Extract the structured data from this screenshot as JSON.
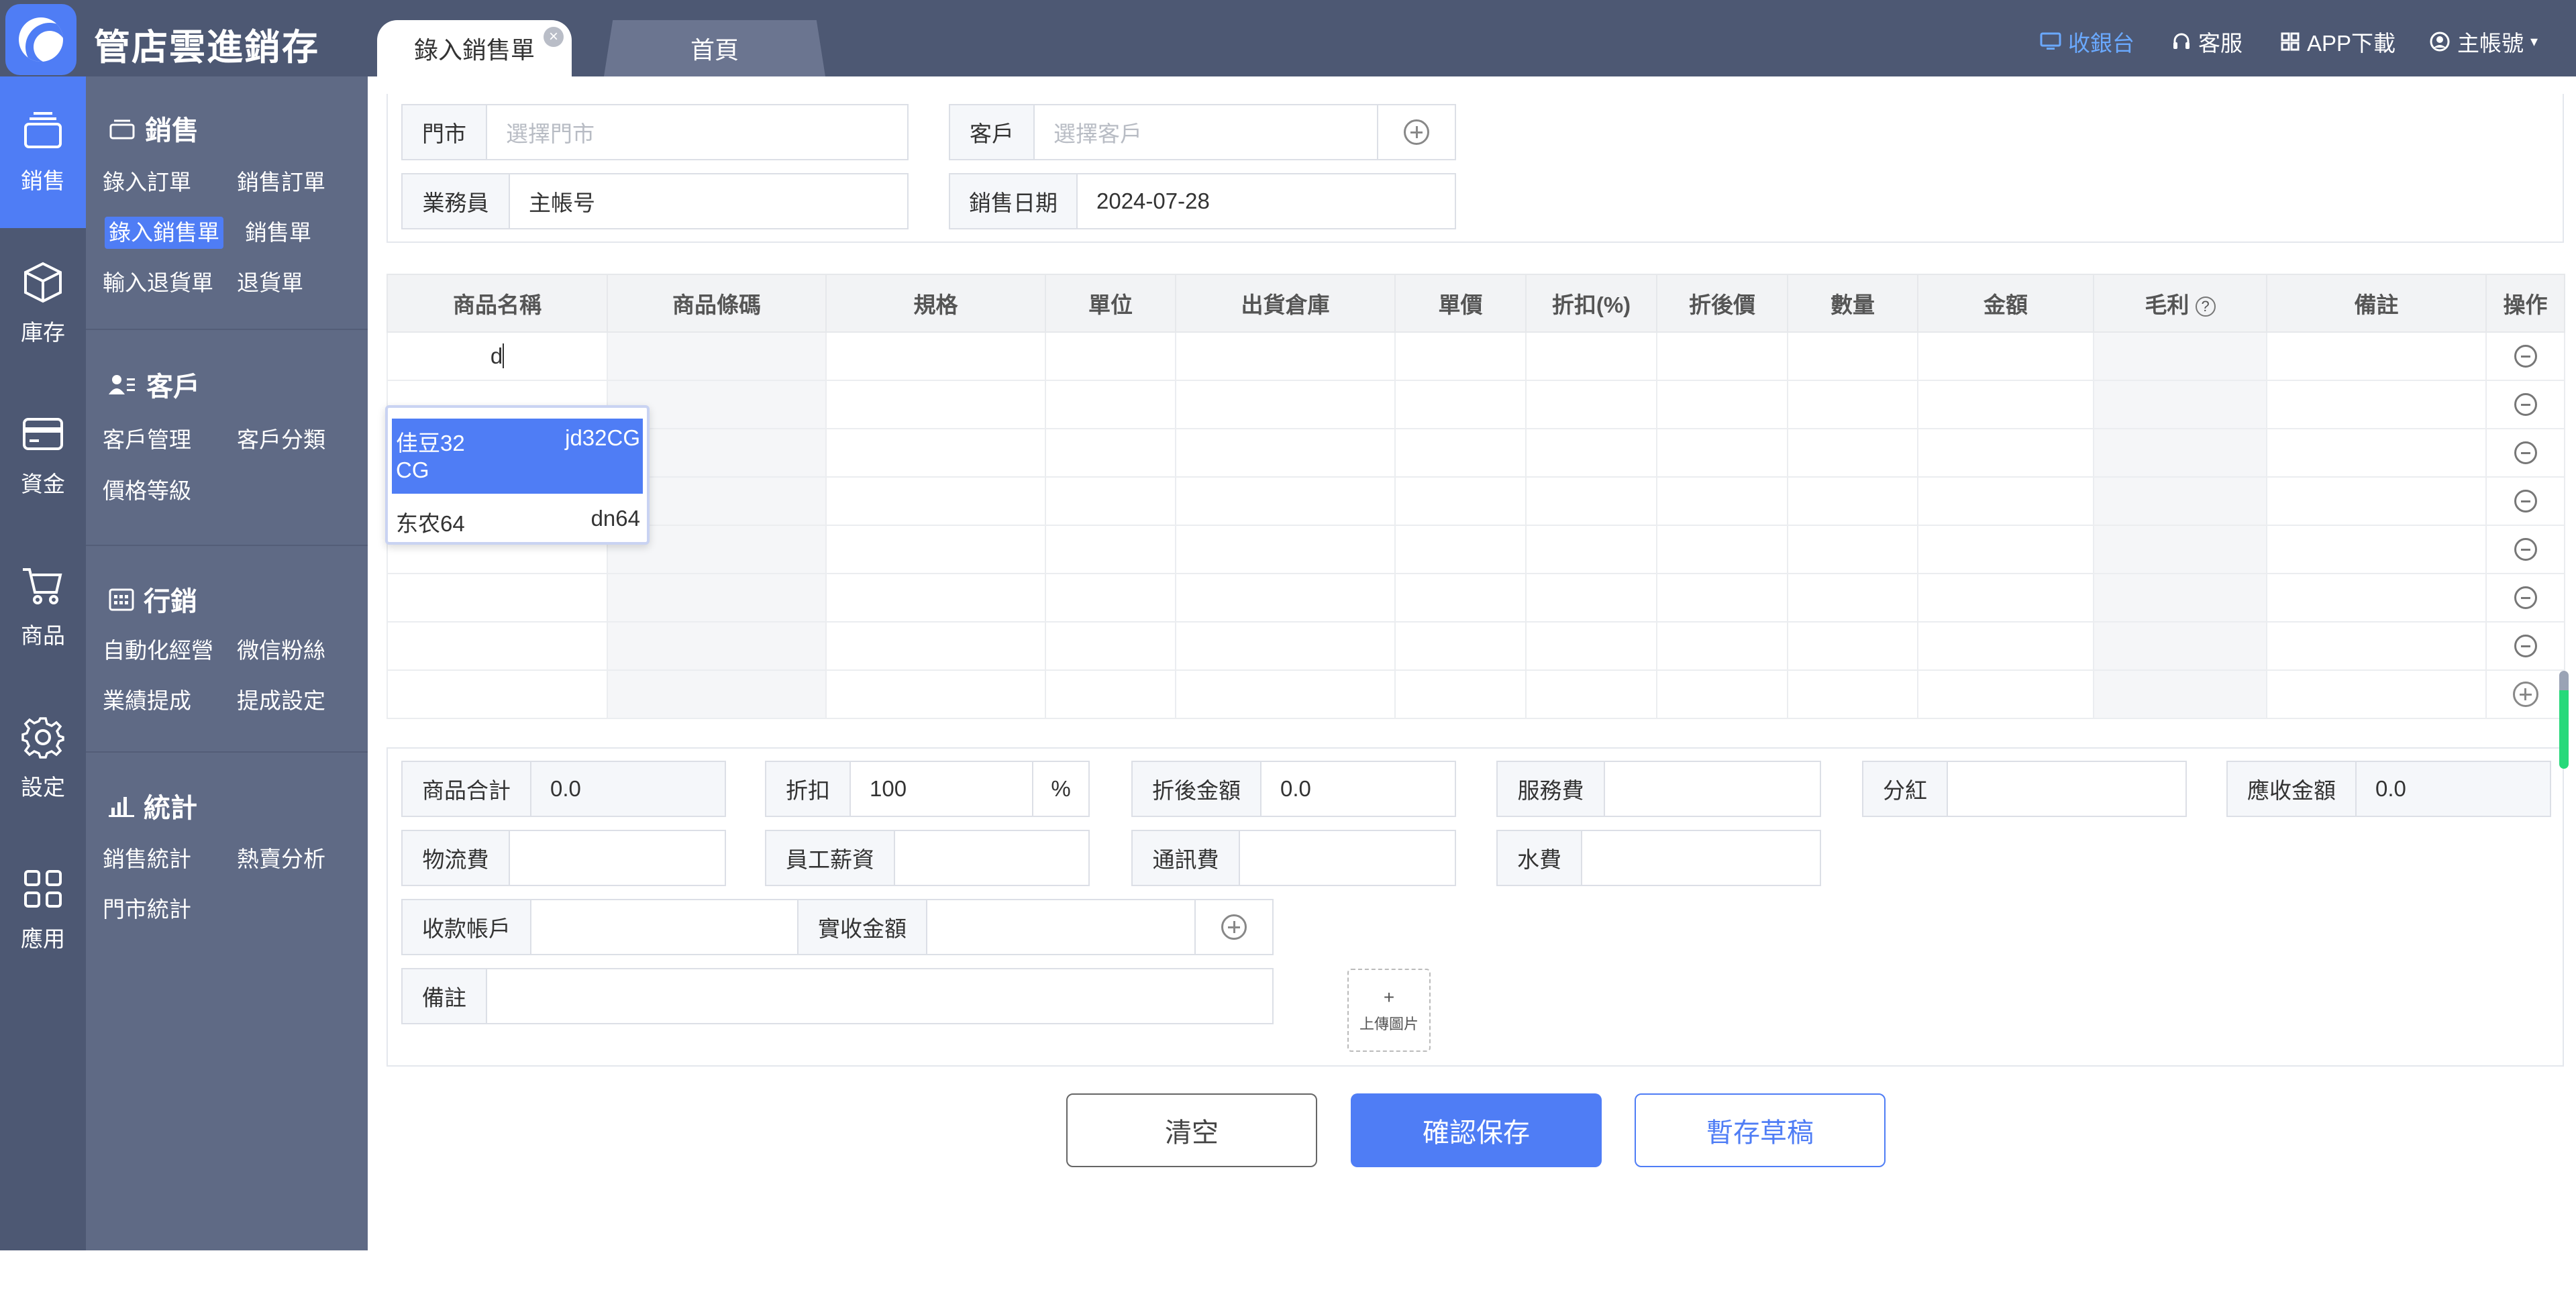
{
  "app": {
    "title": "管店雲進銷存"
  },
  "tabs": [
    {
      "label": "錄入銷售單",
      "close": "×"
    },
    {
      "label": "首頁"
    }
  ],
  "top_links": {
    "cashier": "收銀台",
    "service": "客服",
    "app_download": "APP下載",
    "account": "主帳號"
  },
  "left_nav": [
    {
      "label": "銷售",
      "icon": "sales-icon"
    },
    {
      "label": "庫存",
      "icon": "box-icon"
    },
    {
      "label": "資金",
      "icon": "card-icon"
    },
    {
      "label": "商品",
      "icon": "cart-icon"
    },
    {
      "label": "設定",
      "icon": "gear-icon"
    },
    {
      "label": "應用",
      "icon": "grid-icon"
    }
  ],
  "sub_nav": {
    "sales": {
      "title": "銷售",
      "links": [
        "錄入訂單",
        "銷售訂單",
        "錄入銷售單",
        "銷售單",
        "輸入退貨單",
        "退貨單"
      ]
    },
    "customer": {
      "title": "客戶",
      "links": [
        "客戶管理",
        "客戶分類",
        "價格等級"
      ]
    },
    "marketing": {
      "title": "行銷",
      "links": [
        "自動化經營",
        "微信粉絲",
        "業績提成",
        "提成設定"
      ]
    },
    "stats": {
      "title": "統計",
      "links": [
        "銷售統計",
        "熱賣分析",
        "門市統計"
      ]
    }
  },
  "form": {
    "store_label": "門市",
    "store_placeholder": "選擇門市",
    "customer_label": "客戶",
    "customer_placeholder": "選擇客戶",
    "salesperson_label": "業務員",
    "salesperson_value": "主帳号",
    "date_label": "銷售日期",
    "date_value": "2024-07-28"
  },
  "table": {
    "headers": [
      "商品名稱",
      "商品條碼",
      "規格",
      "單位",
      "出貨倉庫",
      "單價",
      "折扣(%)",
      "折後價",
      "數量",
      "金額",
      "毛利",
      "備註",
      "操作"
    ],
    "first_cell_input": "d",
    "row_count": 8
  },
  "dropdown": [
    {
      "name_line1": "佳豆32",
      "code": "jd32CG",
      "name_line2": "CG"
    },
    {
      "name_line1": "东农64",
      "code": "dn64",
      "name_line2": ""
    }
  ],
  "summary": {
    "total_label": "商品合計",
    "total_value": "0.0",
    "discount_label": "折扣",
    "discount_value": "100",
    "discount_suffix": "%",
    "after_discount_label": "折後金額",
    "after_discount_value": "0.0",
    "service_label": "服務費",
    "service_value": "",
    "bonus_label": "分紅",
    "bonus_value": "",
    "receivable_label": "應收金額",
    "receivable_value": "0.0",
    "logistics_label": "物流費",
    "logistics_value": "",
    "salary_label": "員工薪資",
    "salary_value": "",
    "telecom_label": "通訊費",
    "telecom_value": "",
    "water_label": "水費",
    "water_value": "",
    "account_label": "收款帳戶",
    "account_value": "",
    "received_label": "實收金額",
    "received_value": "",
    "remark_label": "備註",
    "remark_value": "",
    "upload_plus": "+",
    "upload_label": "上傳圖片"
  },
  "buttons": {
    "clear": "清空",
    "save": "確認保存",
    "draft": "暫存草稿"
  }
}
